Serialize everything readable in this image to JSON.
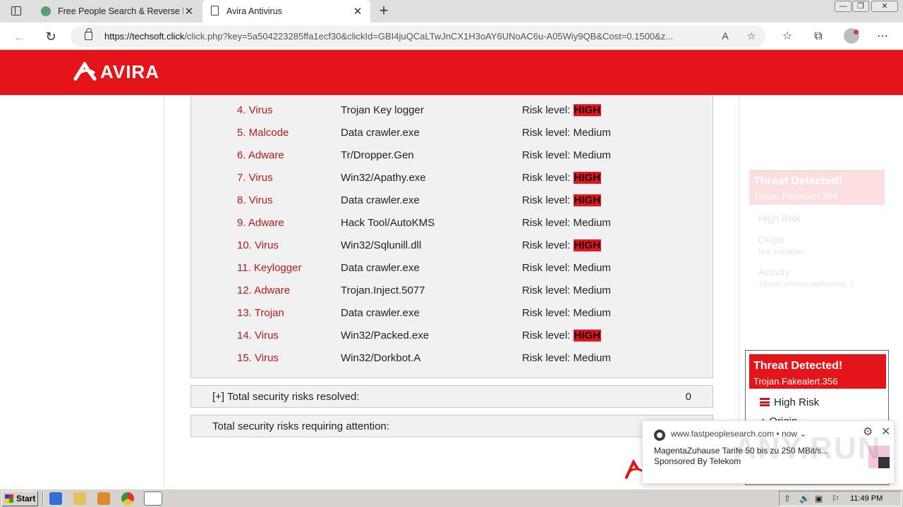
{
  "browser": {
    "tabs": [
      {
        "title": "Free People Search & Reverse Ph",
        "close": "✕",
        "favicon": "paw-icon"
      },
      {
        "title": "Avira Antivirus",
        "close": "✕",
        "favicon": "page-icon"
      }
    ],
    "new_tab": "+",
    "url_host": "https://techsoft.click",
    "url_path": "/click.php?key=5a504223285ffa1ecf30&clickId=GBI4juQCaLTwJnCX1H3oAY6UNoAC6u-A05Wiy9QB&Cost=0.1500&z...",
    "window_controls": {
      "minimize": "—",
      "maximize": "❐",
      "close": "✕"
    }
  },
  "page": {
    "brand": "AVIRA",
    "brand_color": "#e3151a",
    "threats": [
      {
        "type": "4. Virus",
        "name": "Trojan Key logger",
        "risk_prefix": "Risk level: ",
        "risk": "HIGH",
        "high": true
      },
      {
        "type": "5. Malcode",
        "name": "Data crawler.exe",
        "risk_prefix": "Risk level: ",
        "risk": "Medium",
        "high": false
      },
      {
        "type": "6. Adware",
        "name": "Tr/Dropper.Gen",
        "risk_prefix": "Risk level: ",
        "risk": "Medium",
        "high": false
      },
      {
        "type": "7. Virus",
        "name": "Win32/Apathy.exe",
        "risk_prefix": "Risk level: ",
        "risk": "HIGH",
        "high": true
      },
      {
        "type": "8. Virus",
        "name": "Data crawler.exe",
        "risk_prefix": "Risk level: ",
        "risk": "HIGH",
        "high": true
      },
      {
        "type": "9. Adware",
        "name": "Hack Tool/AutoKMS",
        "risk_prefix": "Risk level: ",
        "risk": "Medium",
        "high": false
      },
      {
        "type": "10. Virus",
        "name": "Win32/Sqlunill.dll",
        "risk_prefix": "Risk level: ",
        "risk": "HIGH",
        "high": true
      },
      {
        "type": "11. Keylogger",
        "name": "Data crawler.exe",
        "risk_prefix": "Risk level: ",
        "risk": "Medium",
        "high": false
      },
      {
        "type": "12. Adware",
        "name": "Trojan.Inject.5077",
        "risk_prefix": "Risk level: ",
        "risk": "Medium",
        "high": false
      },
      {
        "type": "13. Trojan",
        "name": "Data crawler.exe",
        "risk_prefix": "Risk level: ",
        "risk": "Medium",
        "high": false
      },
      {
        "type": "14. Virus",
        "name": "Win32/Packed.exe",
        "risk_prefix": "Risk level: ",
        "risk": "HIGH",
        "high": true
      },
      {
        "type": "15. Virus",
        "name": "Win32/Dorkbot.A",
        "risk_prefix": "Risk level: ",
        "risk": "Medium",
        "high": false
      }
    ],
    "resolved_label": "[+] Total security risks resolved:",
    "resolved_value": "0",
    "attention_label": "Total security risks requiring attention:"
  },
  "popup": {
    "title": "Threat Detected!",
    "threat": "Trojan.Fakealert.356",
    "risk": "High Risk",
    "origin": "Origin"
  },
  "ghost_popup": {
    "title": "Threat Detected!",
    "threat": "Trojan.Fakealert.356",
    "risk": "High Risk",
    "origin": "Origin",
    "origin_sub": "Not available",
    "activity": "Activity",
    "activity_sub": "Threat actions performed: 1"
  },
  "toast": {
    "source": "www.fastpeoplesearch.com",
    "time": "• now ⌄",
    "message": "MagentaZuhause Tarife 50 bis zu 250 MBit/s... Sponsored By Telekom",
    "watermark": "ANY.RUN"
  },
  "taskbar": {
    "start": "Start",
    "clock": "11:49 PM"
  }
}
